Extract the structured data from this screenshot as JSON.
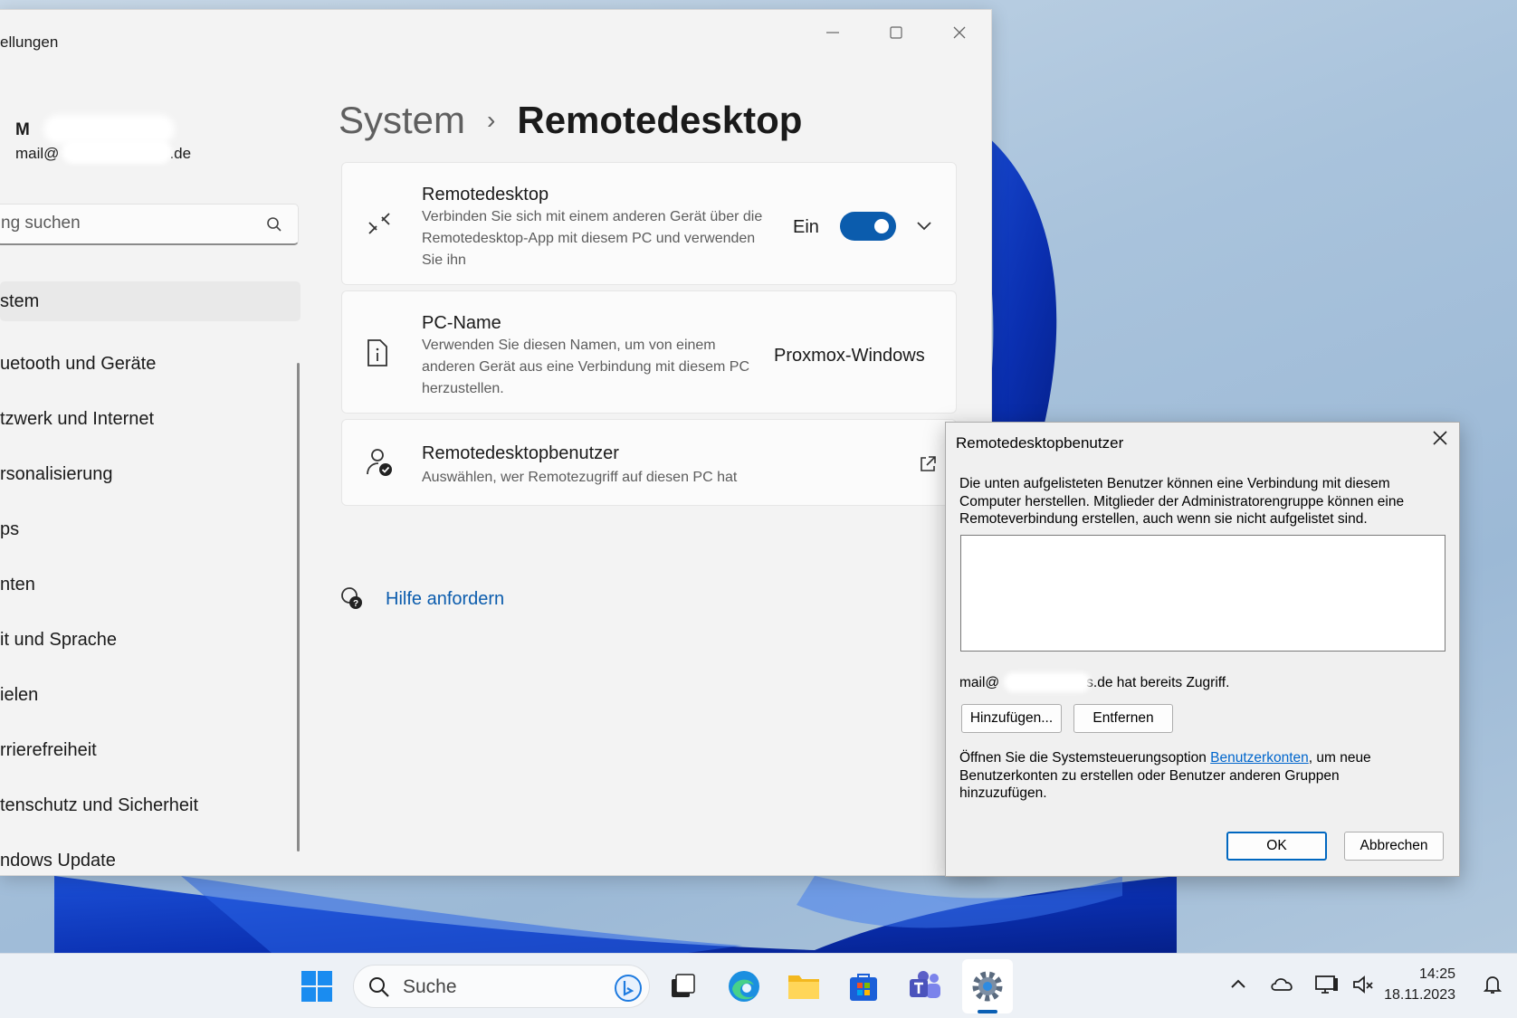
{
  "settings": {
    "window_title": "ellungen",
    "account": {
      "name": "M",
      "mail_start": "mail@",
      "mail_end": ".de"
    },
    "search_placeholder": "ng suchen",
    "nav": [
      "stem",
      "uetooth und Geräte",
      "tzwerk und Internet",
      "rsonalisierung",
      "ps",
      "nten",
      "it und Sprache",
      "ielen",
      "rrierefreiheit",
      "tenschutz und Sicherheit",
      "ndows Update"
    ],
    "breadcrumb": {
      "parent": "System",
      "sep": "›",
      "current": "Remotedesktop"
    },
    "cards": {
      "remote": {
        "title": "Remotedesktop",
        "desc": "Verbinden Sie sich mit einem anderen Gerät über die Remotedesktop-App mit diesem PC und verwenden Sie ihn",
        "toggle_label": "Ein",
        "toggle_on": true
      },
      "pcname": {
        "title": "PC-Name",
        "desc": "Verwenden Sie diesen Namen, um von einem anderen Gerät aus eine Verbindung mit diesem PC herzustellen.",
        "value": "Proxmox-Windows"
      },
      "users": {
        "title": "Remotedesktopbenutzer",
        "desc": "Auswählen, wer Remotezugriff auf diesen PC hat"
      }
    },
    "help": "Hilfe anfordern"
  },
  "dialog": {
    "title": "Remotedesktopbenutzer",
    "desc": "Die unten aufgelisteten Benutzer können eine Verbindung mit diesem Computer herstellen. Mitglieder der Administratorengruppe können eine Remoteverbindung erstellen, auch wenn sie nicht aufgelistet sind.",
    "access_start": "mail@",
    "access_end": "s.de hat bereits Zugriff.",
    "add_button": "Hinzufügen...",
    "remove_button": "Entfernen",
    "note_before": "Öffnen Sie die Systemsteuerungsoption ",
    "note_link": "Benutzerkonten",
    "note_after": ", um neue Benutzerkonten zu erstellen oder Benutzer anderen Gruppen hinzuzufügen.",
    "ok_button": "OK",
    "cancel_button": "Abbrechen"
  },
  "taskbar": {
    "search_label": "Suche",
    "time": "14:25",
    "date": "18.11.2023"
  },
  "colors": {
    "accent": "#0b5cad",
    "link": "#0066cc"
  }
}
